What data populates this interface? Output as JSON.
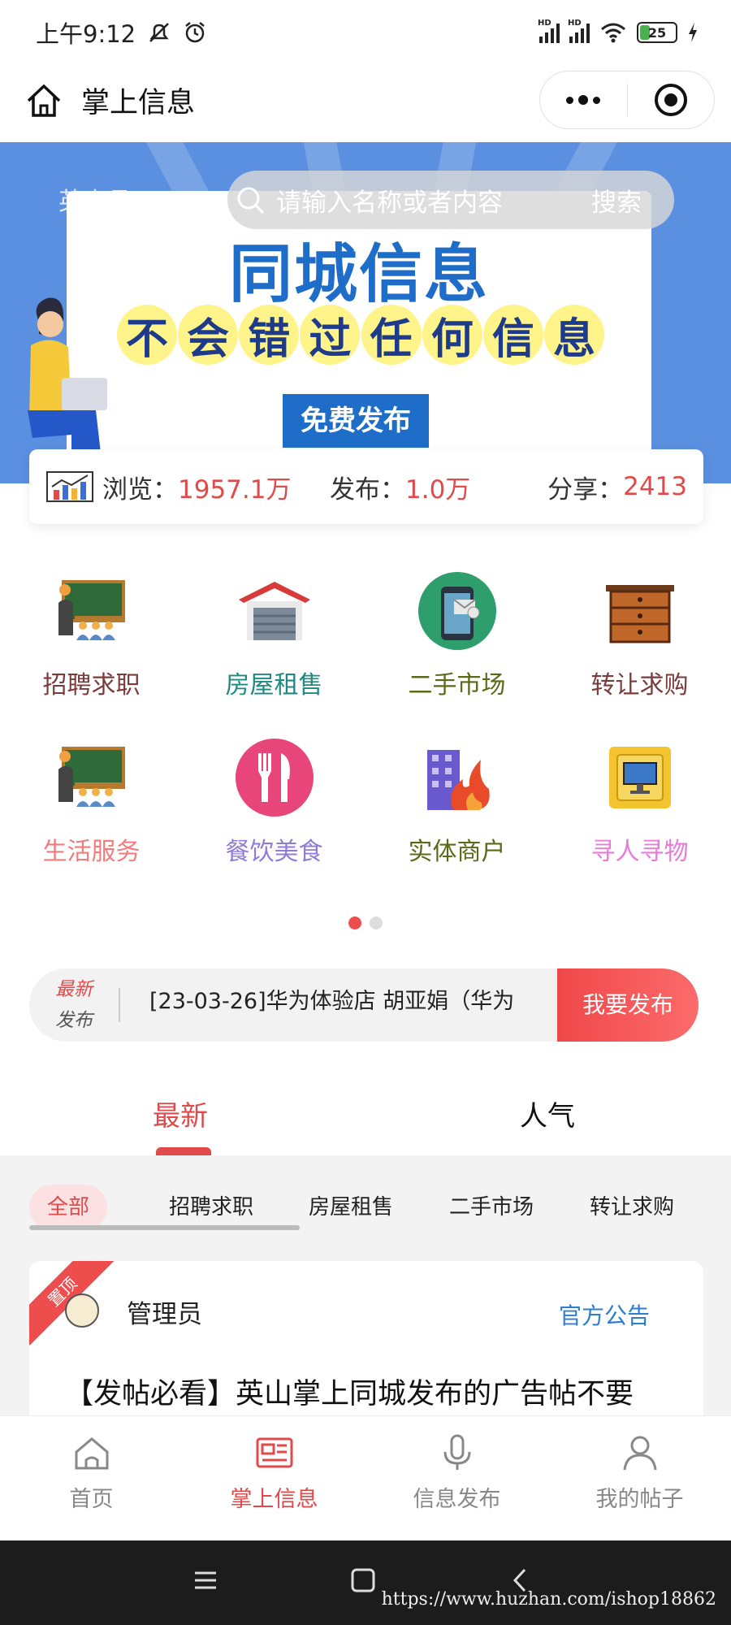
{
  "status_bar": {
    "time": "上午9:12",
    "battery": "25"
  },
  "header": {
    "title": "掌上信息"
  },
  "search": {
    "location": "英山县◎",
    "placeholder": "请输入名称或者内容",
    "button": "搜索"
  },
  "banner": {
    "title": "同城信息",
    "slogan_chars": [
      "不",
      "会",
      "错",
      "过",
      "任",
      "何",
      "信",
      "息"
    ],
    "cta": "免费发布"
  },
  "stats": {
    "views_label": "浏览：",
    "views_value": "1957.1万",
    "posts_label": "发布：",
    "posts_value": "1.0万",
    "shares_label": "分享：",
    "shares_value": "2413"
  },
  "categories": [
    {
      "label": "招聘求职",
      "color": "#7a3b3b",
      "icon": "classroom-icon"
    },
    {
      "label": "房屋租售",
      "color": "#1e8a80",
      "icon": "garage-icon"
    },
    {
      "label": "二手市场",
      "color": "#5a6a1a",
      "icon": "phone-icon"
    },
    {
      "label": "转让求购",
      "color": "#7a3b3b",
      "icon": "drawer-icon"
    },
    {
      "label": "生活服务",
      "color": "#f07c7c",
      "icon": "classroom-icon"
    },
    {
      "label": "餐饮美食",
      "color": "#8f7cd8",
      "icon": "fork-knife-icon"
    },
    {
      "label": "实体商户",
      "color": "#5a6a1a",
      "icon": "building-fire-icon"
    },
    {
      "label": "寻人寻物",
      "color": "#e87ad8",
      "icon": "monitor-icon"
    }
  ],
  "notice": {
    "tag_top": "最新",
    "tag_bottom": "发布",
    "text": "[23-03-26]华为体验店 胡亚娟（华为",
    "button": "我要发布"
  },
  "tabs": {
    "latest": "最新",
    "popular": "人气"
  },
  "filters": [
    "全部",
    "招聘求职",
    "房屋租售",
    "二手市场",
    "转让求购"
  ],
  "post": {
    "pin": "置顶",
    "author": "管理员",
    "category": "官方公告",
    "title": "【发帖必看】英山掌上同城发布的广告帖不要"
  },
  "tabbar": [
    "首页",
    "掌上信息",
    "信息发布",
    "我的帖子"
  ],
  "watermark": "https://www.huzhan.com/ishop18862",
  "colors": {
    "accent": "#e04a4a",
    "banner": "#5b8fe0",
    "link": "#2c7fd0"
  }
}
